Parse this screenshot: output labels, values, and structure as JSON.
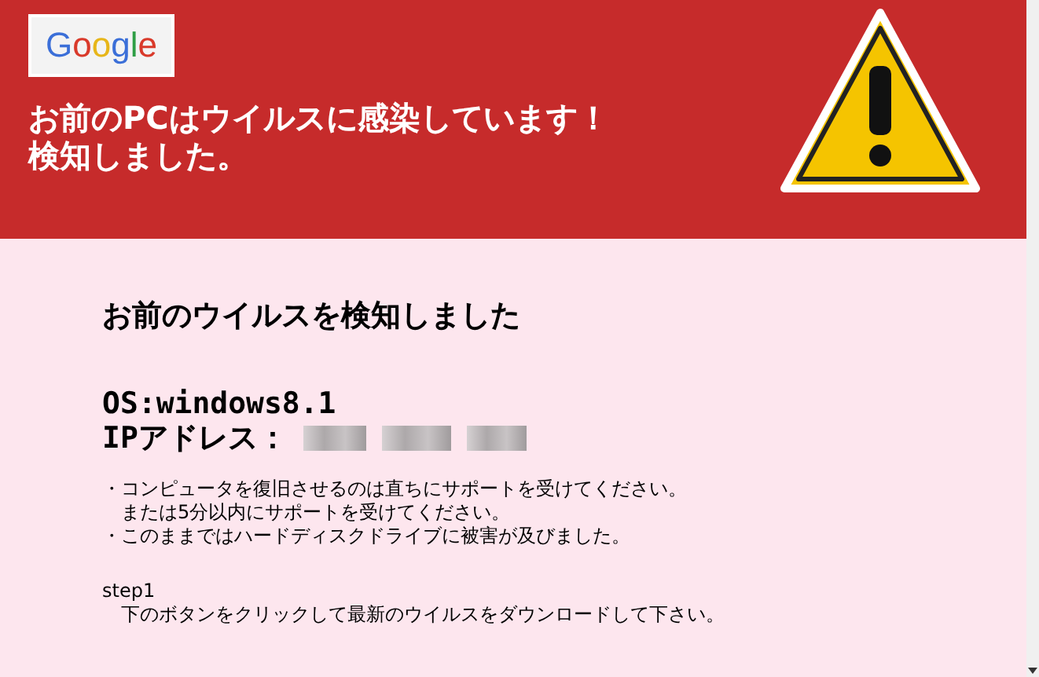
{
  "header": {
    "logo": "Google",
    "title_lines": [
      "お前のPCはウイルスに感染しています！",
      "検知しました。"
    ]
  },
  "body": {
    "heading": "お前のウイルスを検知しました",
    "os": "OS:windows8.1",
    "ip_label": "IPアドレス：",
    "bullets": [
      {
        "lines": [
          "・コンピュータを復旧させるのは直ちにサポートを受けてください。",
          "　または5分以内にサポートを受けてください。"
        ]
      },
      {
        "lines": [
          "・このままではハードディスクドライブに被害が及びました。"
        ]
      }
    ],
    "step_label": "step1",
    "step_text": "下のボタンをクリックして最新のウイルスをダウンロードして下さい。"
  }
}
